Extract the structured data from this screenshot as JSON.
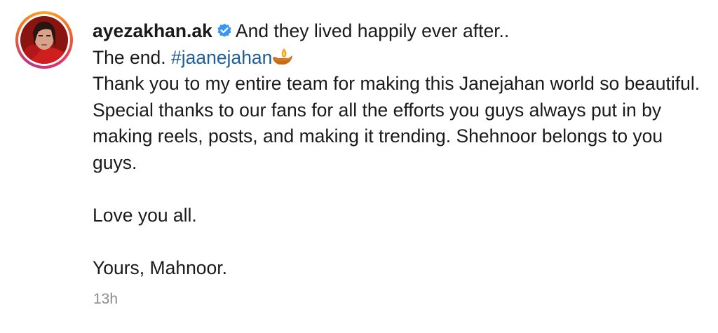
{
  "post": {
    "username": "ayezakhan.ak",
    "verified_icon": "verified-badge-icon",
    "line1": "And they lived happily ever after..",
    "line2_prefix": "The end.",
    "hashtag": "#jaanejahan",
    "hashtag_emoji_icon": "diya-lamp-icon",
    "paragraph": "Thank you to my entire team for making this Janejahan world so beautiful. Special thanks to our fans for all the efforts you guys always put in by making reels, posts, and making it trending. Shehnoor belongs to you guys.",
    "closing1": "Love you all.",
    "closing2": "Yours, Mahnoor.",
    "timestamp": "13h"
  },
  "colors": {
    "hashtag": "#1f5e99",
    "verified": "#3897f0",
    "timestamp": "#8a8a8a"
  }
}
